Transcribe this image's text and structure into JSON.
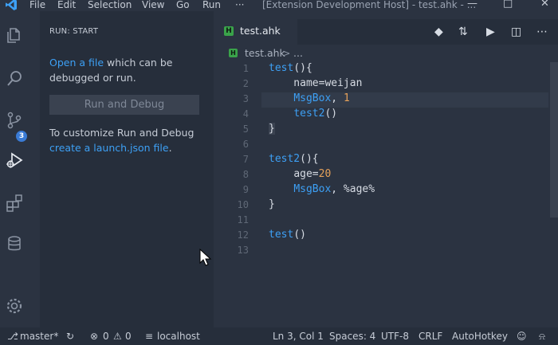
{
  "titlebar": {
    "menus": [
      "File",
      "Edit",
      "Selection",
      "View",
      "Go",
      "Run",
      "···"
    ],
    "title": "[Extension Development Host] - test.ahk - ..."
  },
  "activity": {
    "icons": [
      "files-icon",
      "search-icon",
      "source-control-icon",
      "run-debug-icon",
      "extensions-icon",
      "database-icon",
      "settings-gear-icon"
    ],
    "scm_badge": "3"
  },
  "sidebar": {
    "title": "RUN: START",
    "p1_link": "Open a file",
    "p1_rest": " which can be debugged or run.",
    "run_button": "Run and Debug",
    "p2_text": "To customize Run and Debug",
    "p2_link": "create a launch.json file",
    "p2_end": "."
  },
  "editor": {
    "tab_icon": "H",
    "tab_name": "test.ahk",
    "breadcrumb_file": "test.ahk",
    "breadcrumb_sep": ">",
    "breadcrumb_more": "...",
    "line_numbers": [
      "1",
      "2",
      "3",
      "4",
      "5",
      "6",
      "7",
      "8",
      "9",
      "10",
      "11",
      "12",
      "13"
    ]
  },
  "code": {
    "l1_fn": "test",
    "l1_rest": "(){",
    "l2": "    name=weijan",
    "l3_fn": "MsgBox",
    "l3_comma": ", ",
    "l3_num": "1",
    "l4_fn": "test2",
    "l4_rest": "()",
    "l5": "}",
    "l7_fn": "test2",
    "l7_rest": "(){",
    "l8_a": "age=",
    "l8_num": "20",
    "l9_fn": "MsgBox",
    "l9_rest": ", %age%",
    "l10": "}",
    "l12_fn": "test",
    "l12_rest": "()"
  },
  "status": {
    "branch": "master*",
    "errors": "0",
    "warnings": "0",
    "remote": "localhost",
    "cursor": "Ln 3, Col 1",
    "spaces": "Spaces: 4",
    "encoding": "UTF-8",
    "eol": "CRLF",
    "language": "AutoHotkey"
  },
  "colors": {
    "accent": "#3da0f5",
    "background": "#2b3341",
    "sidebar": "#262e3b",
    "badge": "#3a7bd5",
    "tab_icon": "#3aa34a",
    "number": "#e5a15a"
  }
}
